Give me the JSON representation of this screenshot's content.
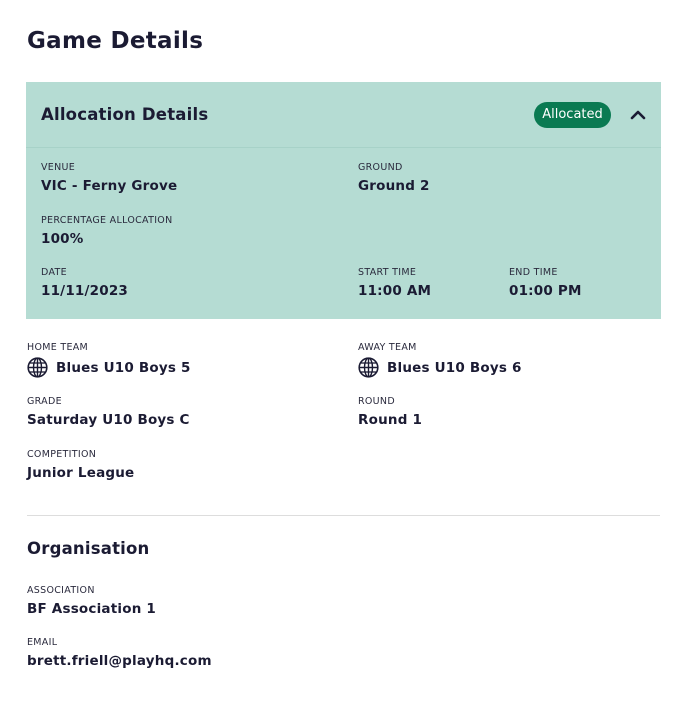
{
  "page": {
    "title": "Game Details"
  },
  "allocation": {
    "title": "Allocation Details",
    "status": "Allocated",
    "venue": {
      "label": "VENUE",
      "value": "VIC - Ferny Grove"
    },
    "ground": {
      "label": "GROUND",
      "value": "Ground 2"
    },
    "percentage": {
      "label": "PERCENTAGE ALLOCATION",
      "value": "100%"
    },
    "date": {
      "label": "DATE",
      "value": "11/11/2023"
    },
    "start_time": {
      "label": "START TIME",
      "value": "11:00 AM"
    },
    "end_time": {
      "label": "END TIME",
      "value": "01:00 PM"
    }
  },
  "game": {
    "home_team": {
      "label": "HOME TEAM",
      "value": "Blues U10 Boys 5",
      "icon": "globe-icon"
    },
    "away_team": {
      "label": "AWAY TEAM",
      "value": "Blues U10 Boys 6",
      "icon": "globe-icon"
    },
    "grade": {
      "label": "GRADE",
      "value": "Saturday U10 Boys C"
    },
    "round": {
      "label": "ROUND",
      "value": "Round 1"
    },
    "competition": {
      "label": "COMPETITION",
      "value": "Junior League"
    }
  },
  "organisation": {
    "title": "Organisation",
    "association": {
      "label": "ASSOCIATION",
      "value": "BF Association 1"
    },
    "email": {
      "label": "EMAIL",
      "value": "brett.friell@playhq.com"
    }
  },
  "colors": {
    "panel_bg": "#b5dcd3",
    "badge_bg": "#0a7a52",
    "text": "#1b1b33"
  }
}
